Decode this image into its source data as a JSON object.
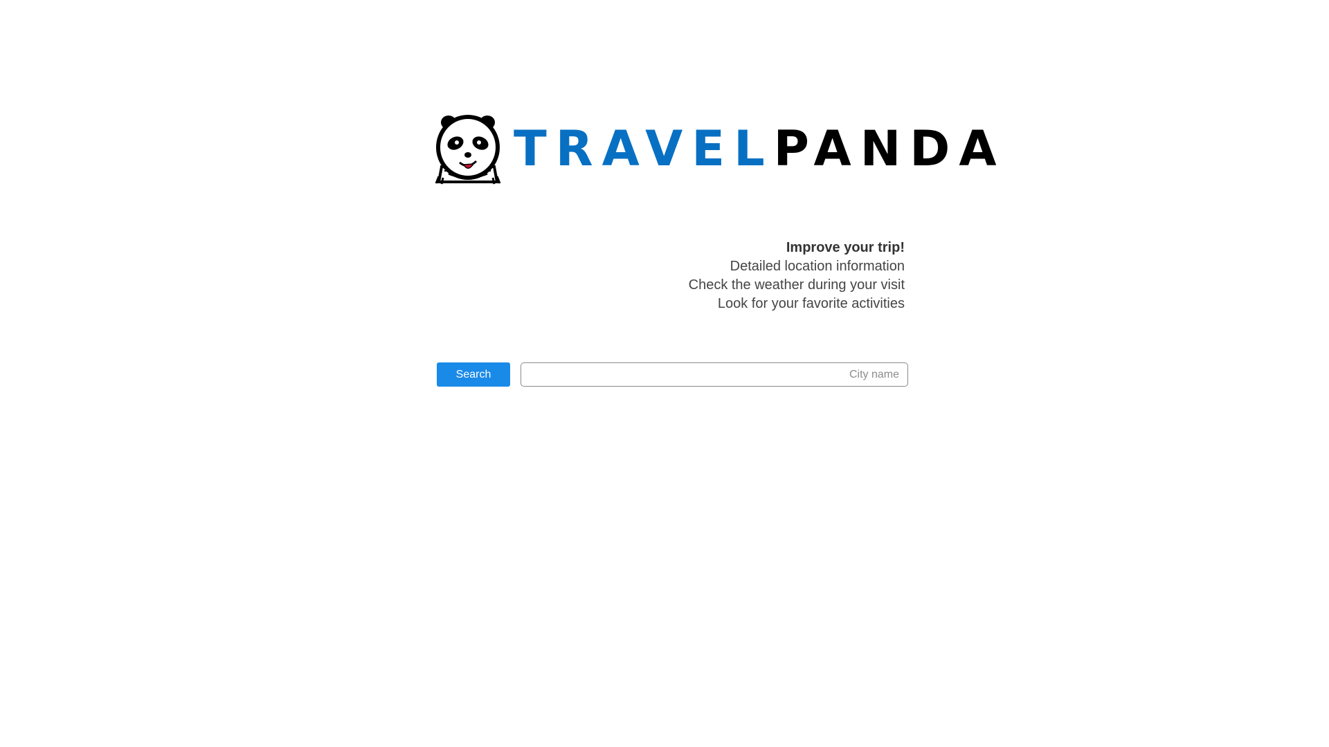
{
  "brand": {
    "logo_text_part1": "TRAVEL",
    "logo_text_part2": "PANDA",
    "logo_icon": "panda-icon",
    "colors": {
      "accent_blue": "#0870c3",
      "text_black": "#000000"
    }
  },
  "features": {
    "headline": "Improve your trip!",
    "items": [
      "Detailed location information",
      "Check the weather during your visit",
      "Look for your favorite activities"
    ]
  },
  "search": {
    "button_label": "Search",
    "input_value": "",
    "input_placeholder": "City name",
    "button_color": "#1a8ae8"
  }
}
